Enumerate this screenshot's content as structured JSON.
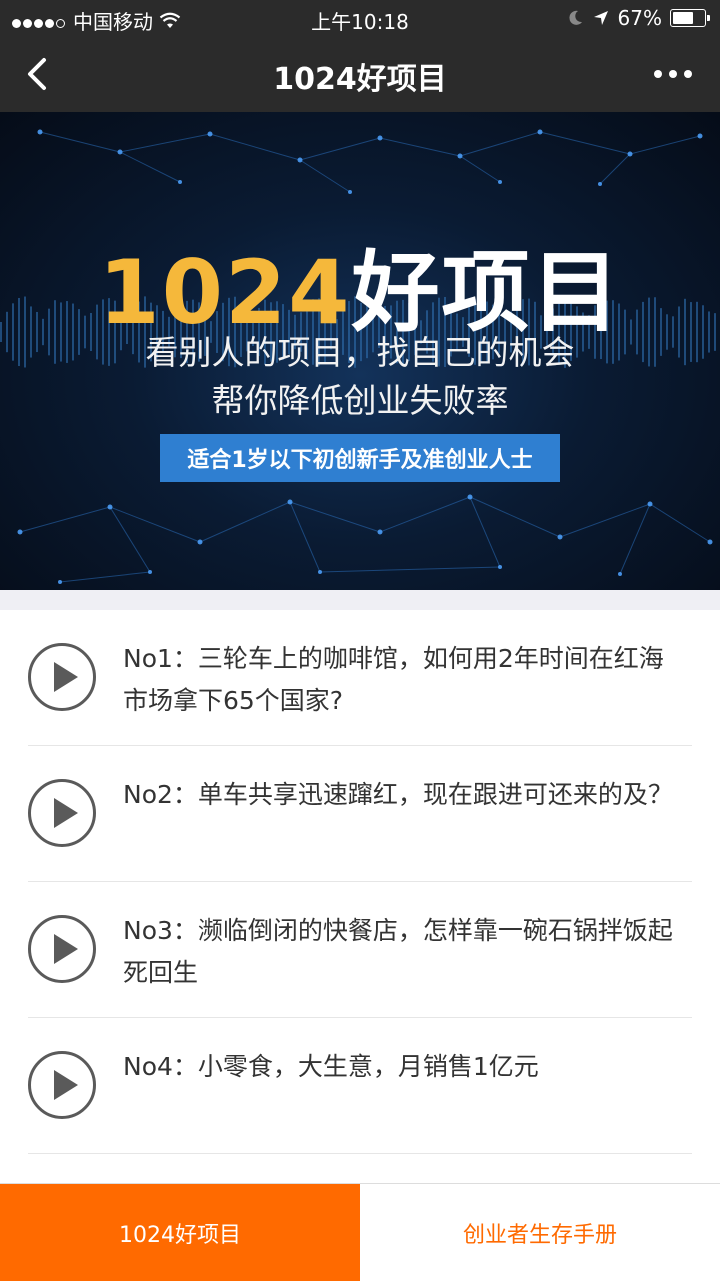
{
  "status": {
    "carrier": "中国移动",
    "time": "上午10:18",
    "battery": "67%",
    "battery_level": 0.67
  },
  "nav": {
    "title": "1024好项目",
    "back_icon": "chevron-left-icon",
    "more_icon": "more-dots-icon"
  },
  "banner": {
    "title_num": "1024",
    "title_text": "好项目",
    "line1": "看别人的项目，找自己的机会",
    "line2": "帮你降低创业失败率",
    "badge": "适合1岁以下初创新手及准创业人士",
    "colors": {
      "accent": "#f5b83b",
      "badge": "#2f7fd1"
    }
  },
  "items": [
    {
      "text": "No1：三轮车上的咖啡馆，如何用2年时间在红海市场拿下65个国家?"
    },
    {
      "text": "No2：单车共享迅速蹿红，现在跟进可还来的及？"
    },
    {
      "text": "No3：濒临倒闭的快餐店，怎样靠一碗石锅拌饭起死回生"
    },
    {
      "text": "No4：小零食，大生意，月销售1亿元"
    }
  ],
  "tabs": {
    "active": "1024好项目",
    "inactive": "创业者生存手册",
    "colors": {
      "primary": "#ff6a00"
    }
  }
}
